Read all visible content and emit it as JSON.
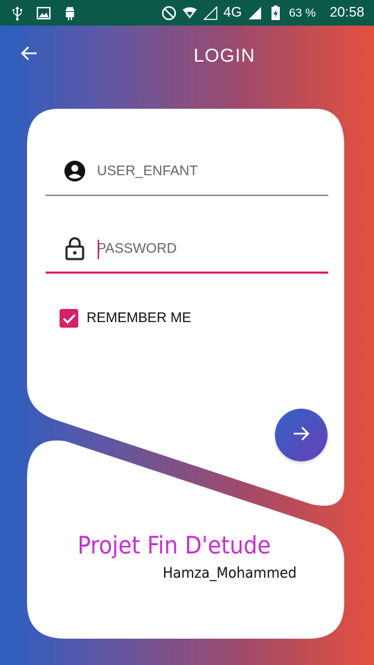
{
  "status_bar": {
    "network": "4G",
    "battery_percent": "63 %",
    "time": "20:58",
    "icons": [
      "usb-icon",
      "image-icon",
      "android-icon",
      "do-not-disturb-icon",
      "wifi-icon",
      "signal-icon",
      "battery-charging-icon"
    ]
  },
  "app_bar": {
    "title": "LOGIN",
    "back_icon": "arrow-back-icon"
  },
  "form": {
    "username": {
      "value": "",
      "placeholder": "USER_ENFANT",
      "icon": "account-circle-icon"
    },
    "password": {
      "value": "",
      "placeholder": "PASSWORD",
      "icon": "lock-icon"
    },
    "remember_me": {
      "label": "REMEMBER ME",
      "checked": true
    },
    "submit_icon": "arrow-forward-icon"
  },
  "footer": {
    "title": "Projet Fin D'etude",
    "author": "Hamza_Mohammed"
  },
  "colors": {
    "status_bar": "#0b5a49",
    "accent": "#d5206a",
    "gradient_start": "#2a5fc0",
    "gradient_end": "#e4503e",
    "credit_title": "#c62ed5"
  }
}
